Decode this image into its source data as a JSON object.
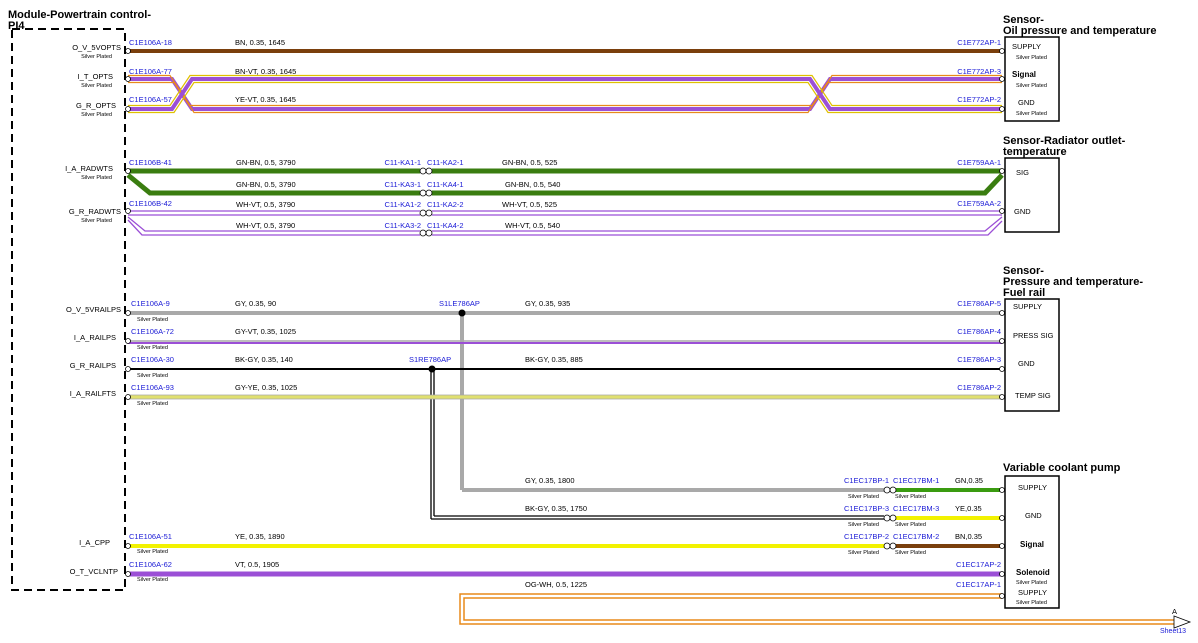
{
  "colors": {
    "brown": "#7a3f0c",
    "purple": "#9b4fd6",
    "orange": "#e88a1a",
    "green": "#3a7d10",
    "gray": "#a9a9a9",
    "black": "#000000",
    "yellow": "#f2f200",
    "connector_text": "#1a1ad6"
  },
  "module": {
    "title_line1": "Module-Powertrain control-",
    "title_line2": "PI4",
    "pins": {
      "o_v_5vopts": "O_V_5VOPTS",
      "i_t_opts": "I_T_OPTS",
      "g_r_opts": "G_R_OPTS",
      "i_a_radwts": "I_A_RADWTS",
      "g_r_radwts": "G_R_RADWTS",
      "o_v_5vrailps": "O_V_5VRAILPS",
      "i_a_railps": "I_A_RAILPS",
      "g_r_railps": "G_R_RAILPS",
      "i_a_railfts": "I_A_RAILFTS",
      "i_a_cpp": "I_A_CPP",
      "o_t_vclntp": "O_T_VCLNTP"
    },
    "plating": "Silver Plated"
  },
  "sensors": {
    "oil": {
      "title_line1": "Sensor-",
      "title_line2": "Oil pressure and temperature",
      "pins": {
        "supply": "SUPPLY",
        "signal": "Signal",
        "gnd": "GND"
      }
    },
    "radiator": {
      "title_line1": "Sensor-Radiator outlet-",
      "title_line2": "temperature",
      "pins": {
        "sig": "SIG",
        "gnd": "GND"
      }
    },
    "fuelrail": {
      "title_line1": "Sensor-",
      "title_line2": "Pressure and temperature-",
      "title_line3": "Fuel rail",
      "pins": {
        "supply": "SUPPLY",
        "press_sig": "PRESS SIG",
        "gnd": "GND",
        "temp_sig": "TEMP SIG"
      }
    },
    "pump": {
      "title": "Variable coolant pump",
      "pins": {
        "supply1": "SUPPLY",
        "gnd": "GND",
        "signal": "Signal",
        "solenoid": "Solenoid",
        "supply2": "SUPPLY"
      }
    }
  },
  "connectors": {
    "c1e106a_18": "C1E106A-18",
    "c1e106a_77": "C1E106A-77",
    "c1e106a_57": "C1E106A-57",
    "c1e772ap_1": "C1E772AP-1",
    "c1e772ap_3": "C1E772AP-3",
    "c1e772ap_2": "C1E772AP-2",
    "c1e106b_41": "C1E106B-41",
    "c1e106b_42": "C1E106B-42",
    "c11_ka1_1": "C11-KA1-1",
    "c11_ka2_1": "C11-KA2-1",
    "c11_ka3_1": "C11-KA3-1",
    "c11_ka4_1": "C11-KA4-1",
    "c11_ka1_2": "C11-KA1-2",
    "c11_ka2_2": "C11-KA2-2",
    "c11_ka3_2": "C11-KA3-2",
    "c11_ka4_2": "C11-KA4-2",
    "c1e759aa_1": "C1E759AA-1",
    "c1e759aa_2": "C1E759AA-2",
    "c1e106a_9": "C1E106A-9",
    "c1e106a_72": "C1E106A-72",
    "c1e106a_30": "C1E106A-30",
    "c1e106a_93": "C1E106A-93",
    "s1le786ap": "S1LE786AP",
    "s1re786ap": "S1RE786AP",
    "c1e786ap_5": "C1E786AP-5",
    "c1e786ap_4": "C1E786AP-4",
    "c1e786ap_3": "C1E786AP-3",
    "c1e786ap_2": "C1E786AP-2",
    "c1ec17bp_1": "C1EC17BP-1",
    "c1ec17bm_1": "C1EC17BM-1",
    "c1ec17bp_3": "C1EC17BP-3",
    "c1ec17bm_3": "C1EC17BM-3",
    "c1ec17bp_2": "C1EC17BP-2",
    "c1ec17bm_2": "C1EC17BM-2",
    "c1e106a_51": "C1E106A-51",
    "c1e106a_62": "C1E106A-62",
    "c1ec17ap_2": "C1EC17AP-2",
    "c1ec17ap_1": "C1EC17AP-1"
  },
  "wires": {
    "w_bn_1645": "BN,  0.35,  1645",
    "w_bnvt_1645": "BN-VT,  0.35,  1645",
    "w_yevt_1645": "YE-VT,  0.35,  1645",
    "w_gnbn_3790_a": "GN-BN,  0.5,  3790",
    "w_gnbn_525": "GN-BN,  0.5,  525",
    "w_gnbn_3790_b": "GN-BN,  0.5,  3790",
    "w_gnbn_540": "GN-BN,  0.5,  540",
    "w_whvt_3790_a": "WH-VT,  0.5,  3790",
    "w_whvt_525": "WH-VT,  0.5,  525",
    "w_whvt_3790_b": "WH-VT,  0.5,  3790",
    "w_whvt_540": "WH-VT,  0.5,  540",
    "w_gy_90": "GY,  0.35,  90",
    "w_gy_935": "GY,  0.35,  935",
    "w_gyvt_1025": "GY-VT,  0.35,  1025",
    "w_bkgy_140": "BK-GY,  0.35,  140",
    "w_bkgy_885": "BK-GY,  0.35,  885",
    "w_gyye_1025": "GY-YE,  0.35,  1025",
    "w_gy_1800": "GY,  0.35,  1800",
    "w_gn_035": "GN,0.35",
    "w_bkgy_1750": "BK-GY,  0.35,  1750",
    "w_ye_035": "YE,0.35",
    "w_ye_1890": "YE,  0.35,  1890",
    "w_bn_035": "BN,0.35",
    "w_vt_1905": "VT,  0.5,  1905",
    "w_ogwh_1225": "OG-WH,  0.5,  1225"
  },
  "offpage": {
    "label": "A",
    "sheet": "Sheet13"
  }
}
